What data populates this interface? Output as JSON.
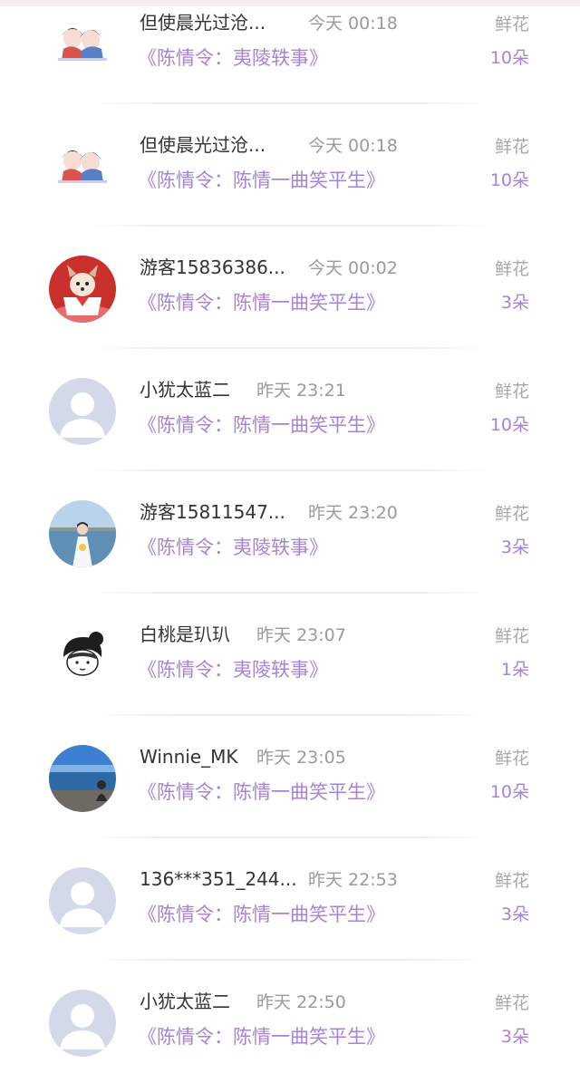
{
  "rows": [
    {
      "name": "但使晨光过沧...",
      "time": "今天 00:18",
      "drama": "《陈情令：夷陵轶事》",
      "gift_label": "鲜花",
      "gift_count": "10朵",
      "avatar": "chibi-couple-avatar"
    },
    {
      "name": "但使晨光过沧...",
      "time": "今天 00:18",
      "drama": "《陈情令：陈情一曲笑平生》",
      "gift_label": "鲜花",
      "gift_count": "10朵",
      "avatar": "chibi-couple-avatar"
    },
    {
      "name": "游客15836386...",
      "time": "今天 00:02",
      "drama": "《陈情令：陈情一曲笑平生》",
      "gift_label": "鲜花",
      "gift_count": "3朵",
      "avatar": "puppy-cup-avatar"
    },
    {
      "name": "小犹太蓝二",
      "time": "昨天 23:21",
      "drama": "《陈情令：陈情一曲笑平生》",
      "gift_label": "鲜花",
      "gift_count": "10朵",
      "avatar": "default-user-avatar"
    },
    {
      "name": "游客15811547...",
      "time": "昨天 23:20",
      "drama": "《陈情令：夷陵轶事》",
      "gift_label": "鲜花",
      "gift_count": "3朵",
      "avatar": "bride-photo-avatar"
    },
    {
      "name": "白桃是玐玐",
      "time": "昨天 23:07",
      "drama": "《陈情令：夷陵轶事》",
      "gift_label": "鲜花",
      "gift_count": "1朵",
      "avatar": "sketch-character-avatar"
    },
    {
      "name": "Winnie_MK",
      "time": "昨天 23:05",
      "drama": "《陈情令：陈情一曲笑平生》",
      "gift_label": "鲜花",
      "gift_count": "10朵",
      "avatar": "lake-photo-avatar"
    },
    {
      "name": "136***351_244...",
      "time": "昨天 22:53",
      "drama": "《陈情令：陈情一曲笑平生》",
      "gift_label": "鲜花",
      "gift_count": "3朵",
      "avatar": "default-user-avatar"
    },
    {
      "name": "小犹太蓝二",
      "time": "昨天 22:50",
      "drama": "《陈情令：陈情一曲笑平生》",
      "gift_label": "鲜花",
      "gift_count": "3朵",
      "avatar": "default-user-avatar"
    }
  ],
  "colors": {
    "accent": "#a783d6",
    "name": "#333333",
    "muted": "#9a9a9a"
  }
}
